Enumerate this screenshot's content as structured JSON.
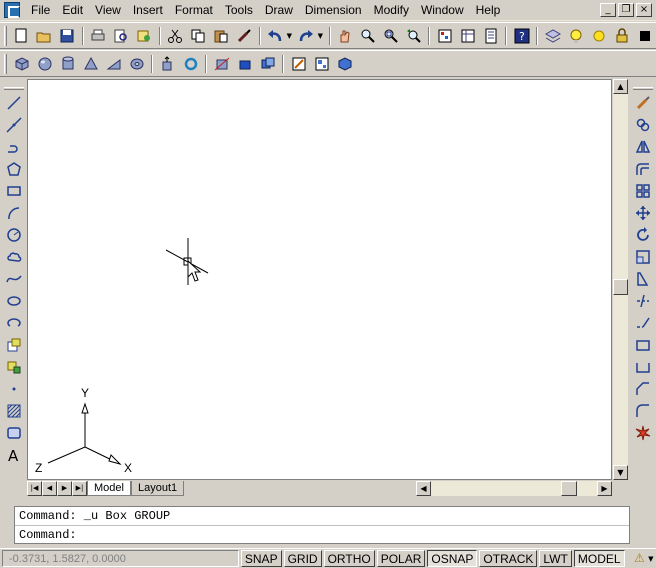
{
  "menu": [
    "File",
    "Edit",
    "View",
    "Insert",
    "Format",
    "Tools",
    "Draw",
    "Dimension",
    "Modify",
    "Window",
    "Help"
  ],
  "window_controls": {
    "minimize": "_",
    "restore": "❐",
    "close": "×"
  },
  "icons": {
    "toolbar1": [
      "new-icon",
      "open-icon",
      "save-icon",
      "plot-icon",
      "plot-preview-icon",
      "publish-icon",
      "cut-icon",
      "copy-icon",
      "paste-icon",
      "match-properties-icon",
      "undo-icon",
      "redo-icon",
      "pan-icon",
      "zoom-realtime-icon",
      "zoom-window-icon",
      "zoom-previous-icon",
      "properties-icon",
      "design-center-icon",
      "tool-palettes-icon",
      "help-icon",
      "layer-manager-icon",
      "layer-state-icon"
    ],
    "toolbar2": [
      "box-icon",
      "sphere-icon",
      "cylinder-icon",
      "cone-icon",
      "wedge-icon",
      "torus-icon",
      "extrude-icon",
      "revolve-icon",
      "slice-icon",
      "section-icon",
      "interfere-icon",
      "setup-drawing-icon",
      "setup-view-icon",
      "setup-profile-icon"
    ],
    "draw": [
      "line-icon",
      "construction-line-icon",
      "polyline-icon",
      "polygon-icon",
      "rectangle-icon",
      "arc-icon",
      "circle-icon",
      "revision-cloud-icon",
      "spline-icon",
      "ellipse-icon",
      "ellipse-arc-icon",
      "insert-block-icon",
      "make-block-icon",
      "point-icon",
      "hatch-icon",
      "region-icon",
      "multiline-text-icon"
    ],
    "modify": [
      "erase-icon",
      "copy-object-icon",
      "mirror-icon",
      "offset-icon",
      "array-icon",
      "move-icon",
      "rotate-icon",
      "scale-icon",
      "stretch-icon",
      "trim-icon",
      "extend-icon",
      "break-at-point-icon",
      "break-icon",
      "chamfer-icon",
      "fillet-icon",
      "explode-icon"
    ]
  },
  "scroll": {
    "up": "▲",
    "down": "▼",
    "left": "◀",
    "right": "▶"
  },
  "ucs": {
    "y": "Y",
    "x": "X",
    "z": "Z"
  },
  "tabs": {
    "nav": [
      "|◀",
      "◀",
      "▶",
      "▶|"
    ],
    "model": "Model",
    "layout1": "Layout1"
  },
  "command": {
    "history": "Command: _u Box GROUP",
    "prompt": "Command:"
  },
  "status": {
    "coordinates": "-0.3731, 1.5827, 0.0000",
    "buttons": [
      {
        "label": "SNAP",
        "on": false
      },
      {
        "label": "GRID",
        "on": false
      },
      {
        "label": "ORTHO",
        "on": false
      },
      {
        "label": "POLAR",
        "on": false
      },
      {
        "label": "OSNAP",
        "on": true
      },
      {
        "label": "OTRACK",
        "on": false
      },
      {
        "label": "LWT",
        "on": false
      },
      {
        "label": "MODEL",
        "on": true
      }
    ]
  }
}
